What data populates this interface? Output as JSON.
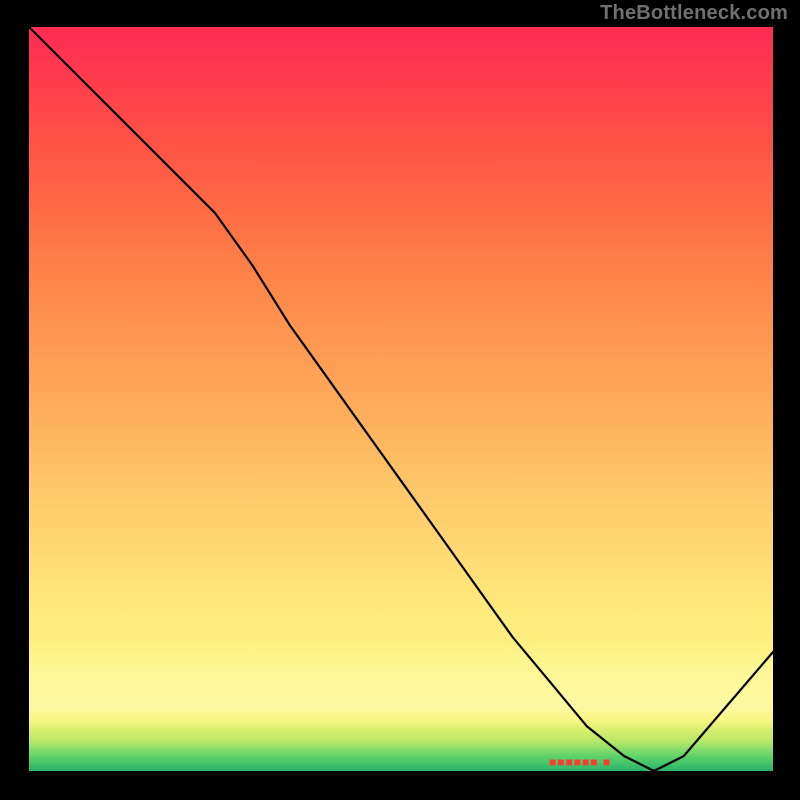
{
  "attribution": "TheBottleneck.com",
  "marker_label": "■■■■■■ ■",
  "colors": {
    "frame": "#000000",
    "curve": "#000000",
    "attribution_text": "#707070",
    "marker_text": "#ff3b30",
    "gradient_top": "#ff2c55",
    "gradient_bottom": "#29b36a"
  },
  "chart_data": {
    "type": "line",
    "title": "",
    "xlabel": "",
    "ylabel": "",
    "xlim": [
      0,
      100
    ],
    "ylim": [
      0,
      100
    ],
    "x": [
      0,
      8,
      12,
      20,
      25,
      30,
      35,
      40,
      45,
      50,
      55,
      60,
      65,
      70,
      75,
      80,
      84,
      88,
      100
    ],
    "values": [
      100,
      92,
      88,
      80,
      75,
      68,
      60,
      53,
      46,
      39,
      32,
      25,
      18,
      12,
      6,
      2,
      0,
      2,
      16
    ],
    "minimum_x": 84,
    "background": "vertical-rainbow-green-to-red",
    "highlight_band_y": [
      5,
      17
    ]
  }
}
